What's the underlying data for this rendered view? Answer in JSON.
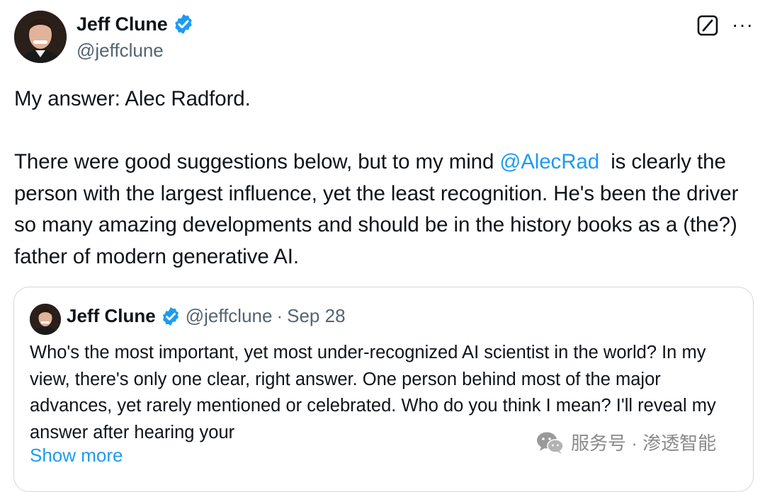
{
  "author": {
    "name": "Jeff Clune",
    "handle": "@jeffclune",
    "verified": true,
    "verified_color": "#1d9bf0"
  },
  "actions": {
    "grok_icon": "grok-icon",
    "more_label": "···"
  },
  "tweet": {
    "line1": "My answer: Alec Radford.",
    "line2_before": "There were good suggestions below, but to my mind ",
    "mention": "@AlecRad",
    "line2_after": "  is clearly the person with the largest influence, yet the least recognition. He's been the driver so many amazing developments and should be in the history books as a (the?) father of modern generative AI.",
    "mention_color": "#1d9bf0"
  },
  "quote": {
    "name": "Jeff Clune",
    "handle": "@jeffclune",
    "separator": "·",
    "date": "Sep 28",
    "text": "Who's the most important, yet most under-recognized AI scientist in the world? In my view, there's only one clear, right answer. One person behind most of the major advances, yet rarely mentioned or celebrated. Who do you think I mean? I'll reveal my answer after hearing your",
    "show_more": "Show more"
  },
  "watermark": {
    "text": "服务号 · 渗透智能",
    "icon": "wechat-icon"
  }
}
